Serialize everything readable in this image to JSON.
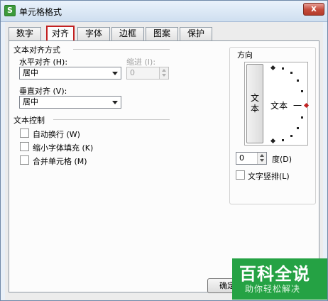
{
  "window": {
    "title": "单元格格式",
    "icon_label": "S",
    "close_label": "x"
  },
  "tabs": [
    "数字",
    "对齐",
    "字体",
    "边框",
    "图案",
    "保护"
  ],
  "active_tab": "对齐",
  "alignment": {
    "section_title": "文本对齐方式",
    "horizontal_label": "水平对齐 (H):",
    "horizontal_value": "居中",
    "indent_label": "缩进 (I):",
    "indent_value": "0",
    "vertical_label": "垂直对齐 (V):",
    "vertical_value": "居中"
  },
  "text_control": {
    "section_title": "文本控制",
    "options": [
      "自动换行 (W)",
      "缩小字体填充 (K)",
      "合并单元格 (M)"
    ]
  },
  "orientation": {
    "section_title": "方向",
    "vertical_text": "文本",
    "dial_text": "文本",
    "dial_line": "一",
    "degree_value": "0",
    "degree_label": "度(D)",
    "vertical_checkbox_label": "文字竖排(L)"
  },
  "buttons": {
    "ok": "确定"
  },
  "watermark": {
    "main": "百科全说",
    "sub": "助你轻松解决"
  },
  "colors": {
    "tab_highlight": "#c22020",
    "watermark_bg": "#25a244"
  }
}
